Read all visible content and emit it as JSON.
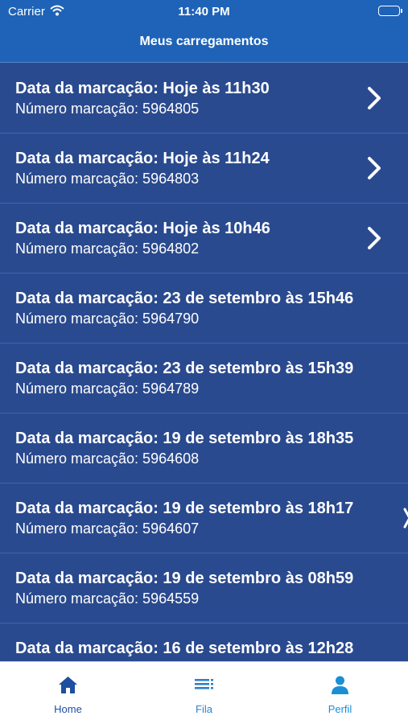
{
  "status_bar": {
    "carrier": "Carrier",
    "time": "11:40 PM"
  },
  "header": {
    "title": "Meus carregamentos"
  },
  "bookings": [
    {
      "date": "Data da marcação: Hoje às 11h30",
      "number": "Número marcação: 5964805",
      "chevron": true
    },
    {
      "date": "Data da marcação: Hoje às 11h24",
      "number": "Número marcação: 5964803",
      "chevron": true
    },
    {
      "date": "Data da marcação: Hoje às 10h46",
      "number": "Número marcação: 5964802",
      "chevron": true
    },
    {
      "date": "Data da marcação: 23 de setembro às 15h46",
      "number": "Número marcação: 5964790",
      "chevron": false
    },
    {
      "date": "Data da marcação: 23 de setembro às 15h39",
      "number": "Número marcação: 5964789",
      "chevron": false
    },
    {
      "date": "Data da marcação: 19 de setembro às 18h35",
      "number": "Número marcação: 5964608",
      "chevron": false
    },
    {
      "date": "Data da marcação: 19 de setembro às 18h17",
      "number": "Número marcação: 5964607",
      "chevron": false
    },
    {
      "date": "Data da marcação: 19 de setembro às 08h59",
      "number": "Número marcação: 5964559",
      "chevron": false
    },
    {
      "date": "Data da marcação: 16 de setembro às 12h28",
      "number": "",
      "chevron": false
    }
  ],
  "tab_bar": {
    "home": {
      "label": "Home",
      "icon": "home-icon"
    },
    "fila": {
      "label": "Fila",
      "icon": "list-icon"
    },
    "perfil": {
      "label": "Perfil",
      "icon": "person-icon"
    }
  },
  "colors": {
    "header_blue": "#1e63b8",
    "list_background": "#2a4a8f",
    "row_separator": "#3e64ad",
    "tab_home": "#1e4fa0",
    "tab_fila": "#2d82c8",
    "tab_perfil": "#1a8fd6"
  }
}
